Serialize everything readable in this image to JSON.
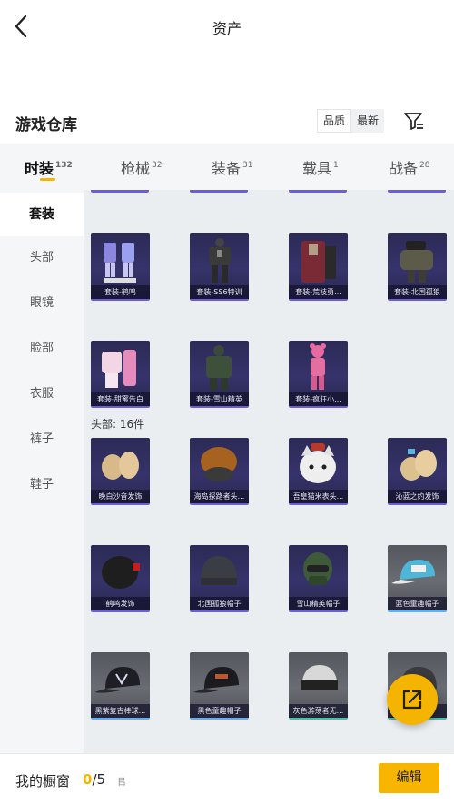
{
  "header": {
    "title": "资产"
  },
  "warehouse": {
    "title": "游戏仓库",
    "sort_options": [
      "品质",
      "最新"
    ],
    "active_sort": "品质"
  },
  "tabs": [
    {
      "label": "时装",
      "count": "132"
    },
    {
      "label": "枪械",
      "count": "32"
    },
    {
      "label": "装备",
      "count": "31"
    },
    {
      "label": "载具",
      "count": "1"
    },
    {
      "label": "战备",
      "count": "28"
    }
  ],
  "sidebar": {
    "items": [
      {
        "label": "套装"
      },
      {
        "label": "头部"
      },
      {
        "label": "眼镜"
      },
      {
        "label": "脸部"
      },
      {
        "label": "衣服"
      },
      {
        "label": "裤子"
      },
      {
        "label": "鞋子"
      }
    ]
  },
  "suits": {
    "items": [
      {
        "name": "套装-鹤鸣",
        "icon": "outfit-icon"
      },
      {
        "name": "套装-SS6特训",
        "icon": "outfit-icon"
      },
      {
        "name": "套装-荒枝勇...",
        "icon": "outfit-icon"
      },
      {
        "name": "套装-北国孤狼",
        "icon": "outfit-icon"
      },
      {
        "name": "套装-甜蜜告白",
        "icon": "outfit-icon"
      },
      {
        "name": "套装-雪山精英",
        "icon": "outfit-icon"
      },
      {
        "name": "套装-疯狂小...",
        "icon": "outfit-icon"
      }
    ]
  },
  "head": {
    "label": "头部: 16件",
    "items": [
      {
        "name": "晚白沙音发饰",
        "icon": "hair-accessory-icon"
      },
      {
        "name": "海岛探路者头...",
        "icon": "hair-accessory-icon"
      },
      {
        "name": "吾皇猫米表头...",
        "icon": "cat-head-icon"
      },
      {
        "name": "沁蓝之约发饰",
        "icon": "hair-accessory-icon"
      },
      {
        "name": "鹤鸣发饰",
        "icon": "hair-accessory-icon"
      },
      {
        "name": "北国孤狼帽子",
        "icon": "beanie-icon"
      },
      {
        "name": "雪山精英帽子",
        "icon": "mask-helmet-icon"
      },
      {
        "name": "蓝色童趣帽子",
        "icon": "cap-icon"
      },
      {
        "name": "黑紫复古棒球...",
        "icon": "cap-icon"
      },
      {
        "name": "黑色童趣帽子",
        "icon": "cap-icon"
      },
      {
        "name": "灰色游荡者无...",
        "icon": "cap-icon"
      }
    ]
  },
  "bottom": {
    "label": "我的橱窗",
    "count_current": "0",
    "count_max": "/5",
    "lock_glyph": "㠯",
    "edit_label": "编辑"
  },
  "colors": {
    "accent": "#f5b400",
    "card_dark": "#2c2a55",
    "card_border": "#6b5fd6"
  }
}
